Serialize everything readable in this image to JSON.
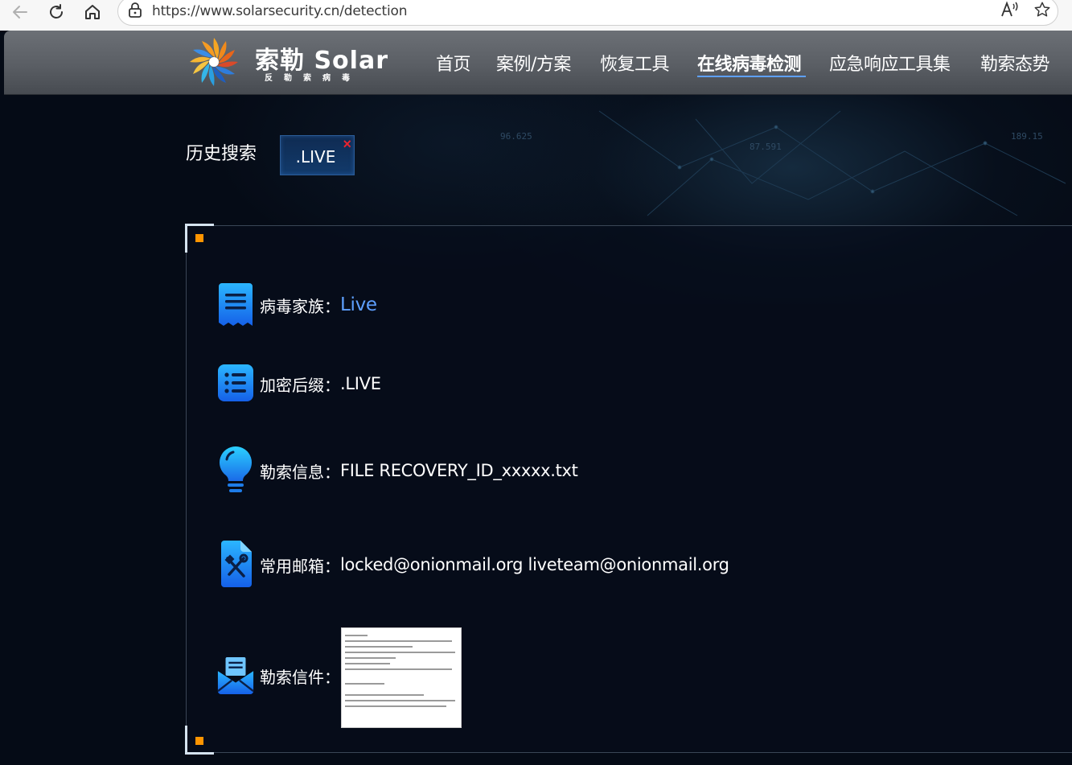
{
  "browser": {
    "url": "https://www.solarsecurity.cn/detection"
  },
  "brand": {
    "title": "索勒 Solar",
    "subtitle": "反勒索病毒"
  },
  "nav": [
    {
      "label": "首页"
    },
    {
      "label": "案例/方案"
    },
    {
      "label": "恢复工具"
    },
    {
      "label": "在线病毒检测",
      "active": true
    },
    {
      "label": "应急响应工具集"
    },
    {
      "label": "勒索态势"
    }
  ],
  "background": {
    "numbers": [
      "96.625",
      "87.591",
      "189.15"
    ]
  },
  "history": {
    "label": "历史搜索",
    "chip": ".LIVE",
    "close": "×"
  },
  "result": {
    "family_label": "病毒家族：",
    "family_value": "Live",
    "suffix_label": "加密后缀：",
    "suffix_value": ".LIVE",
    "note_label": "勒索信息：",
    "note_value": "FILE RECOVERY_ID_xxxxx.txt",
    "email_label": "常用邮箱：",
    "email_value": "locked@onionmail.org liveteam@onionmail.org",
    "letter_label": "勒索信件："
  },
  "colors": {
    "accent": "#5ea0ff",
    "corner_dot": "#ff9500",
    "close_red": "#e8242f"
  },
  "icons": [
    "back-icon",
    "refresh-icon",
    "home-icon",
    "lock-icon",
    "read-aloud-icon",
    "star-icon",
    "receipt-icon",
    "list-icon",
    "lightbulb-icon",
    "tools-icon",
    "envelope-icon"
  ]
}
